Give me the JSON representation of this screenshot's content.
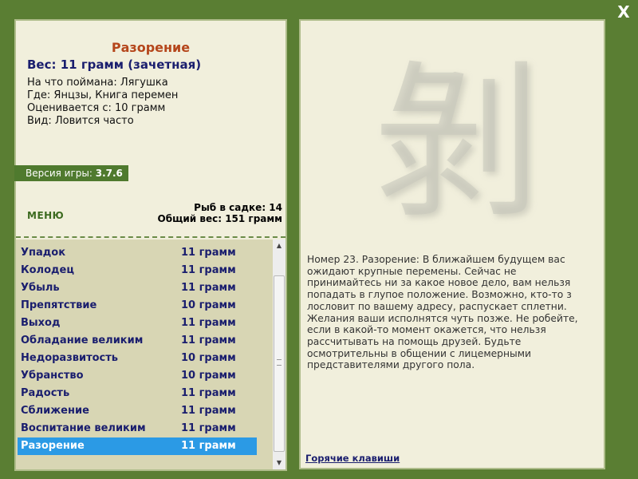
{
  "window": {
    "close_label": "X"
  },
  "fish": {
    "name": "Разорение",
    "weight_line": "Вес: 11 грамм (зачетная)",
    "caught_on": "На что поймана: Лягушка",
    "location": "Где: Янцзы, Книга перемен",
    "valued_from": "Оценивается с: 10 грамм",
    "view": "Вид: Ловится часто"
  },
  "version": {
    "label": "Версия игры:",
    "value": "3.7.6"
  },
  "menu_label": "МЕНЮ",
  "stats": {
    "count": "Рыб в садке: 14",
    "total": "Общий вес: 151 грамм"
  },
  "list": [
    {
      "name": "Упадок",
      "weight": "11 грамм"
    },
    {
      "name": "Колодец",
      "weight": "11 грамм"
    },
    {
      "name": "Убыль",
      "weight": "11 грамм"
    },
    {
      "name": "Препятствие",
      "weight": "10 грамм"
    },
    {
      "name": "Выход",
      "weight": "11 грамм"
    },
    {
      "name": "Обладание великим",
      "weight": "11 грамм"
    },
    {
      "name": "Недоразвитость",
      "weight": "10 грамм"
    },
    {
      "name": "Убранство",
      "weight": "10 грамм"
    },
    {
      "name": "Радость",
      "weight": "11 грамм"
    },
    {
      "name": "Сближение",
      "weight": "11 грамм"
    },
    {
      "name": "Воспитание великим",
      "weight": "11 грамм"
    },
    {
      "name": "Разорение",
      "weight": "11 грамм"
    }
  ],
  "selected_item": "Разорение",
  "hexagram_glyph": "剝",
  "description": "Номер 23. Разорение: В ближайшем будущем вас ожидают крупные перемены. Сейчас не принимайтесь ни за какое новое дело, вам нельзя попадать в глупое положение. Возможно, кто-то з лословит по вашему адресу, распускает сплетни. Желания ваши исполнятся чуть позже. Не робейте, если в какой-то момент окажется, что нельзя рассчитывать на помощь друзей. Будьте осмотрительны в общении с лицемерными представителями другого пола.",
  "hotkeys_label": "Горячие клавиши",
  "colors": {
    "background": "#5a7e33",
    "panel": "#f1efdc",
    "list_bg": "#d8d6b4",
    "selection": "#2b9ae5",
    "title": "#b5461b",
    "link": "#1a1e6e"
  }
}
